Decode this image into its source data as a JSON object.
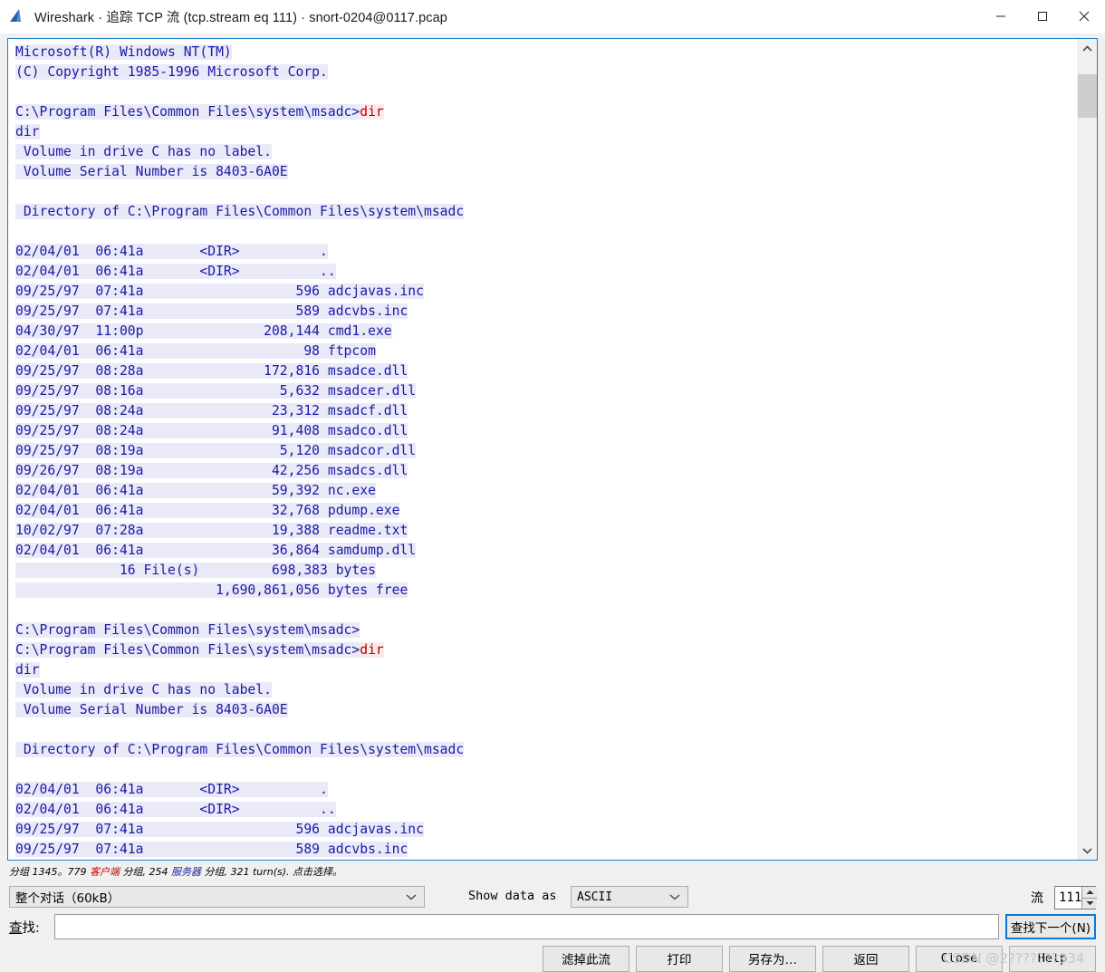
{
  "window": {
    "title": "Wireshark · 追踪 TCP 流 (tcp.stream eq 111) · snort-0204@0117.pcap",
    "minimize_label": "minimize",
    "maximize_label": "maximize",
    "close_label": "close"
  },
  "stream": {
    "lines": [
      {
        "t": "srv",
        "text": "Microsoft(R) Windows NT(TM)"
      },
      {
        "t": "srv",
        "text": "(C) Copyright 1985-1996 Microsoft Corp."
      },
      {
        "t": "blank",
        "text": ""
      },
      {
        "t": "mix",
        "srv": "C:\\Program Files\\Common Files\\system\\msadc>",
        "cli": "dir"
      },
      {
        "t": "srv",
        "text": "dir"
      },
      {
        "t": "srv",
        "text": " Volume in drive C has no label."
      },
      {
        "t": "srv",
        "text": " Volume Serial Number is 8403-6A0E"
      },
      {
        "t": "blank",
        "text": ""
      },
      {
        "t": "srv",
        "text": " Directory of C:\\Program Files\\Common Files\\system\\msadc"
      },
      {
        "t": "blank",
        "text": ""
      },
      {
        "t": "srv",
        "text": "02/04/01  06:41a       <DIR>          ."
      },
      {
        "t": "srv",
        "text": "02/04/01  06:41a       <DIR>          .."
      },
      {
        "t": "srv",
        "text": "09/25/97  07:41a                   596 adcjavas.inc"
      },
      {
        "t": "srv",
        "text": "09/25/97  07:41a                   589 adcvbs.inc"
      },
      {
        "t": "srv",
        "text": "04/30/97  11:00p               208,144 cmd1.exe"
      },
      {
        "t": "srv",
        "text": "02/04/01  06:41a                    98 ftpcom"
      },
      {
        "t": "srv",
        "text": "09/25/97  08:28a               172,816 msadce.dll"
      },
      {
        "t": "srv",
        "text": "09/25/97  08:16a                 5,632 msadcer.dll"
      },
      {
        "t": "srv",
        "text": "09/25/97  08:24a                23,312 msadcf.dll"
      },
      {
        "t": "srv",
        "text": "09/25/97  08:24a                91,408 msadco.dll"
      },
      {
        "t": "srv",
        "text": "09/25/97  08:19a                 5,120 msadcor.dll"
      },
      {
        "t": "srv",
        "text": "09/26/97  08:19a                42,256 msadcs.dll"
      },
      {
        "t": "srv",
        "text": "02/04/01  06:41a                59,392 nc.exe"
      },
      {
        "t": "srv",
        "text": "02/04/01  06:41a                32,768 pdump.exe"
      },
      {
        "t": "srv",
        "text": "10/02/97  07:28a                19,388 readme.txt"
      },
      {
        "t": "srv",
        "text": "02/04/01  06:41a                36,864 samdump.dll"
      },
      {
        "t": "srv",
        "text": "             16 File(s)         698,383 bytes"
      },
      {
        "t": "srv",
        "text": "                         1,690,861,056 bytes free"
      },
      {
        "t": "blank",
        "text": ""
      },
      {
        "t": "srv",
        "text": "C:\\Program Files\\Common Files\\system\\msadc>"
      },
      {
        "t": "mix",
        "srv": "C:\\Program Files\\Common Files\\system\\msadc>",
        "cli": "dir"
      },
      {
        "t": "srv",
        "text": "dir"
      },
      {
        "t": "srv",
        "text": " Volume in drive C has no label."
      },
      {
        "t": "srv",
        "text": " Volume Serial Number is 8403-6A0E"
      },
      {
        "t": "blank",
        "text": ""
      },
      {
        "t": "srv",
        "text": " Directory of C:\\Program Files\\Common Files\\system\\msadc"
      },
      {
        "t": "blank",
        "text": ""
      },
      {
        "t": "srv",
        "text": "02/04/01  06:41a       <DIR>          ."
      },
      {
        "t": "srv",
        "text": "02/04/01  06:41a       <DIR>          .."
      },
      {
        "t": "srv",
        "text": "09/25/97  07:41a                   596 adcjavas.inc"
      },
      {
        "t": "srv",
        "text": "09/25/97  07:41a                   589 adcvbs.inc"
      }
    ]
  },
  "status": {
    "prefix": "分组 1345。779 ",
    "client_word": "客户端",
    "middle": " 分组, 254 ",
    "server_word": "服务器",
    "suffix": " 分组, 321 turn(s). 点击选择。"
  },
  "options": {
    "conversation_value": "整个对话（60kB）",
    "show_data_as_label": "Show data as",
    "show_data_as_value": "ASCII",
    "stream_label": "流",
    "stream_value": "111",
    "chevron": "⌄"
  },
  "find": {
    "label_mnemonic": "查",
    "label_rest": "找:",
    "input_value": "",
    "placeholder": "",
    "find_next_label": "查找下一个(N)"
  },
  "buttons": {
    "filter_out": "滤掉此流",
    "print": "打印",
    "save_as": "另存为…",
    "back": "返回",
    "close": "Close",
    "help": "Help"
  },
  "watermark": {
    "text": "CSDN @2???????934"
  },
  "colors": {
    "server_text": "#1a1aa8",
    "server_bg": "#e9e9f7",
    "client_text": "#bb0000",
    "client_bg": "#fbeaea",
    "focus_border": "#0a79d4",
    "window_border": "#1f7fc4"
  }
}
